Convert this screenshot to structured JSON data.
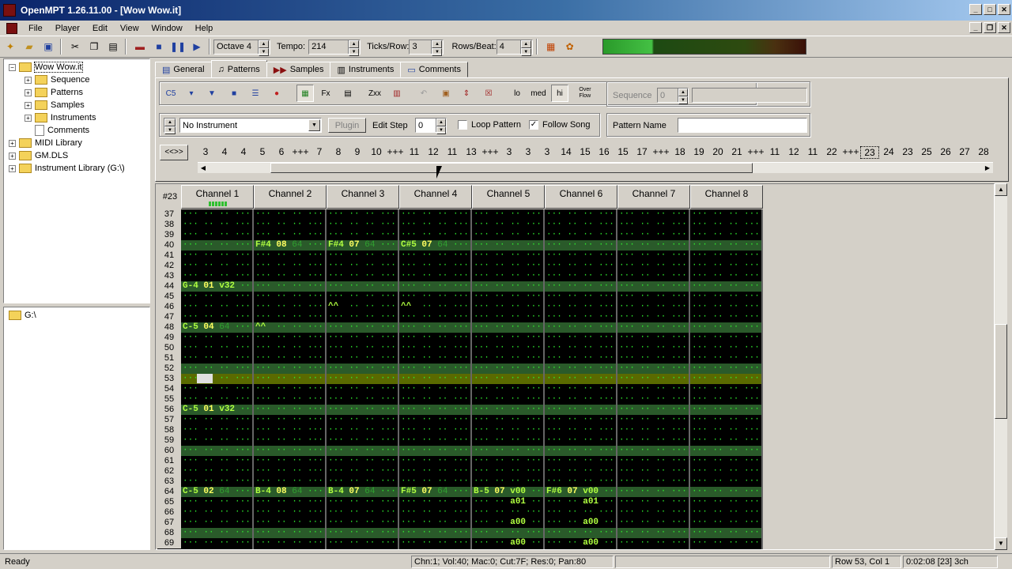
{
  "window": {
    "title": "OpenMPT 1.26.11.00 - [Wow Wow.it]"
  },
  "menu": [
    "File",
    "Player",
    "Edit",
    "View",
    "Window",
    "Help"
  ],
  "toolbar": {
    "octave_label": "Octave 4",
    "tempo_label": "Tempo:",
    "tempo_value": "214",
    "ticks_label": "Ticks/Row:",
    "ticks_value": "3",
    "rpb_label": "Rows/Beat:",
    "rpb_value": "4"
  },
  "tree": {
    "root": "Wow Wow.it",
    "children": [
      "Sequence",
      "Patterns",
      "Samples",
      "Instruments",
      "Comments"
    ],
    "others": [
      "MIDI Library",
      "GM.DLS",
      "Instrument Library (G:\\)"
    ],
    "drive": "G:\\"
  },
  "tabs": [
    "General",
    "Patterns",
    "Samples",
    "Instruments",
    "Comments"
  ],
  "pattern_ctrl": {
    "q_lo": "lo",
    "q_med": "med",
    "q_hi": "hi",
    "overflow": "Over\nFlow",
    "sequence_label": "Sequence",
    "sequence_value": "0",
    "instrument": "No Instrument",
    "plugin": "Plugin",
    "edit_step_label": "Edit Step",
    "edit_step_value": "0",
    "loop_pattern": "Loop Pattern",
    "follow_song": "Follow Song",
    "pattern_name_label": "Pattern Name",
    "pattern_name_value": ""
  },
  "order_nav": "<<>>",
  "order_list": [
    "3",
    "4",
    "4",
    "5",
    "6",
    "+++",
    "7",
    "8",
    "9",
    "10",
    "+++",
    "11",
    "12",
    "11",
    "13",
    "+++",
    "3",
    "3",
    "3",
    "14",
    "15",
    "16",
    "15",
    "17",
    "+++",
    "18",
    "19",
    "20",
    "21",
    "+++",
    "11",
    "12",
    "11",
    "22",
    "+++",
    "23",
    "24",
    "23",
    "25",
    "26",
    "27",
    "28"
  ],
  "pattern": {
    "number": "#23",
    "channels": [
      "Channel 1",
      "Channel 2",
      "Channel 3",
      "Channel 4",
      "Channel 5",
      "Channel 6",
      "Channel 7",
      "Channel 8"
    ],
    "rows": [
      "37",
      "38",
      "39",
      "40",
      "41",
      "42",
      "43",
      "44",
      "45",
      "46",
      "47",
      "48",
      "49",
      "50",
      "51",
      "52",
      "53",
      "54",
      "55",
      "56",
      "57",
      "58",
      "59",
      "60",
      "61",
      "62",
      "63",
      "64",
      "65",
      "66",
      "67",
      "68",
      "69"
    ],
    "empty_cell": "··· ·· ·· ···",
    "events": [
      {
        "row": "40",
        "ch": 1,
        "note": "F#4",
        "ins": "08",
        "vol": "v64"
      },
      {
        "row": "40",
        "ch": 2,
        "note": "F#4",
        "ins": "07",
        "vol": "v64"
      },
      {
        "row": "40",
        "ch": 3,
        "note": "C#5",
        "ins": "07",
        "vol": "v64"
      },
      {
        "row": "44",
        "ch": 0,
        "note": "G-4",
        "ins": "01",
        "vol": "v32"
      },
      {
        "row": "46",
        "ch": 2,
        "note": "^^",
        "ins": "",
        "vol": ""
      },
      {
        "row": "46",
        "ch": 3,
        "note": "^^",
        "ins": "",
        "vol": ""
      },
      {
        "row": "48",
        "ch": 0,
        "note": "C-5",
        "ins": "04",
        "vol": "v64"
      },
      {
        "row": "48",
        "ch": 1,
        "note": "^^",
        "ins": "",
        "vol": ""
      },
      {
        "row": "56",
        "ch": 0,
        "note": "C-5",
        "ins": "01",
        "vol": "v32"
      },
      {
        "row": "64",
        "ch": 0,
        "note": "C-5",
        "ins": "02",
        "vol": "v64"
      },
      {
        "row": "64",
        "ch": 1,
        "note": "B-4",
        "ins": "08",
        "vol": "v64"
      },
      {
        "row": "64",
        "ch": 2,
        "note": "B-4",
        "ins": "07",
        "vol": "v64"
      },
      {
        "row": "64",
        "ch": 3,
        "note": "F#5",
        "ins": "07",
        "vol": "v64"
      },
      {
        "row": "64",
        "ch": 4,
        "note": "B-5",
        "ins": "07",
        "vol": "v00"
      },
      {
        "row": "64",
        "ch": 5,
        "note": "F#6",
        "ins": "07",
        "vol": "v00"
      },
      {
        "row": "65",
        "ch": 4,
        "note": "",
        "ins": "",
        "vol": "a01"
      },
      {
        "row": "65",
        "ch": 5,
        "note": "",
        "ins": "",
        "vol": "a01"
      },
      {
        "row": "67",
        "ch": 4,
        "note": "",
        "ins": "",
        "vol": "a00"
      },
      {
        "row": "67",
        "ch": 5,
        "note": "",
        "ins": "",
        "vol": "a00"
      },
      {
        "row": "69",
        "ch": 4,
        "note": "",
        "ins": "",
        "vol": "a00"
      },
      {
        "row": "69",
        "ch": 5,
        "note": "",
        "ins": "",
        "vol": "a00"
      }
    ]
  },
  "status": {
    "ready": "Ready",
    "info": "Chn:1; Vol:40; Mac:0; Cut:7F; Res:0; Pan:80",
    "pos": "Row 53, Col 1",
    "time": "0:02:08  [23] 3ch"
  },
  "colors": {
    "bg": "#000000",
    "note": "#b0ff40",
    "dots": "#2ee82e",
    "highlight_row": "#5a6a00",
    "beat_row": "#2a5a2a"
  }
}
